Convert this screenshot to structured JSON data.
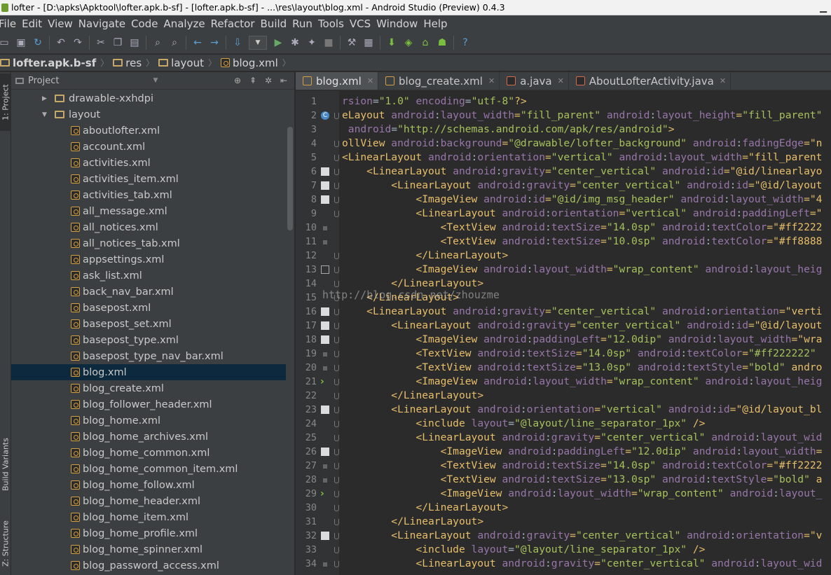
{
  "window": {
    "title": "lofter - [D:\\apks\\Apktool\\lofter.apk.b-sf] - [lofter.apk.b-sf] - ...\\res\\layout\\blog.xml - Android Studio (Preview) 0.4.3"
  },
  "menu": [
    "File",
    "Edit",
    "View",
    "Navigate",
    "Code",
    "Analyze",
    "Refactor",
    "Build",
    "Run",
    "Tools",
    "VCS",
    "Window",
    "Help"
  ],
  "breadcrumb": [
    "lofter.apk.b-sf",
    "res",
    "layout",
    "blog.xml"
  ],
  "left_stripe": {
    "project_tab": "1: Project",
    "build_variants_tab": "Build Variants",
    "structure_tab": "Z: Structure"
  },
  "project_panel": {
    "header": "Project",
    "tree": [
      {
        "label": "drawable-xxhdpi",
        "kind": "folder",
        "expanded": false
      },
      {
        "label": "layout",
        "kind": "folder",
        "expanded": true
      },
      {
        "label": "aboutlofter.xml",
        "kind": "file"
      },
      {
        "label": "account.xml",
        "kind": "file"
      },
      {
        "label": "activities.xml",
        "kind": "file"
      },
      {
        "label": "activities_item.xml",
        "kind": "file"
      },
      {
        "label": "activities_tab.xml",
        "kind": "file"
      },
      {
        "label": "all_message.xml",
        "kind": "file"
      },
      {
        "label": "all_notices.xml",
        "kind": "file"
      },
      {
        "label": "all_notices_tab.xml",
        "kind": "file"
      },
      {
        "label": "appsettings.xml",
        "kind": "file"
      },
      {
        "label": "ask_list.xml",
        "kind": "file"
      },
      {
        "label": "back_nav_bar.xml",
        "kind": "file"
      },
      {
        "label": "basepost.xml",
        "kind": "file"
      },
      {
        "label": "basepost_set.xml",
        "kind": "file"
      },
      {
        "label": "basepost_type.xml",
        "kind": "file"
      },
      {
        "label": "basepost_type_nav_bar.xml",
        "kind": "file"
      },
      {
        "label": "blog.xml",
        "kind": "file",
        "selected": true
      },
      {
        "label": "blog_create.xml",
        "kind": "file"
      },
      {
        "label": "blog_follower_header.xml",
        "kind": "file"
      },
      {
        "label": "blog_home.xml",
        "kind": "file"
      },
      {
        "label": "blog_home_archives.xml",
        "kind": "file"
      },
      {
        "label": "blog_home_common.xml",
        "kind": "file"
      },
      {
        "label": "blog_home_common_item.xml",
        "kind": "file"
      },
      {
        "label": "blog_home_follow.xml",
        "kind": "file"
      },
      {
        "label": "blog_home_header.xml",
        "kind": "file"
      },
      {
        "label": "blog_home_item.xml",
        "kind": "file"
      },
      {
        "label": "blog_home_profile.xml",
        "kind": "file"
      },
      {
        "label": "blog_home_spinner.xml",
        "kind": "file"
      },
      {
        "label": "blog_password_access.xml",
        "kind": "file"
      }
    ]
  },
  "editor_tabs": [
    {
      "label": "blog.xml",
      "active": true,
      "type": "xml"
    },
    {
      "label": "blog_create.xml",
      "active": false,
      "type": "xml"
    },
    {
      "label": "a.java",
      "active": false,
      "type": "java"
    },
    {
      "label": "AboutLofterActivity.java",
      "active": false,
      "type": "java"
    }
  ],
  "watermark": "http://blog.csdn.net/zhouzme",
  "code_lines": [
    "rsion=\"1.0\" encoding=\"utf-8\"?>",
    "eLayout android:layout_width=\"fill_parent\" android:layout_height=\"fill_parent\"",
    " android=\"http://schemas.android.com/apk/res/android\">",
    "ollView android:background=\"@drawable/lofter_background\" android:fadingEdge=\"n",
    "<LinearLayout android:orientation=\"vertical\" android:layout_width=\"fill_parent",
    "    <LinearLayout android:gravity=\"center_vertical\" android:id=\"@id/linearlayo",
    "        <LinearLayout android:gravity=\"center_vertical\" android:id=\"@id/layout",
    "            <ImageView android:id=\"@id/img_msg_header\" android:layout_width=\"4",
    "            <LinearLayout android:orientation=\"vertical\" android:paddingLeft=\"",
    "                <TextView android:textSize=\"14.0sp\" android:textColor=\"#ff2222",
    "                <TextView android:textSize=\"10.0sp\" android:textColor=\"#ff8888",
    "            </LinearLayout>",
    "            <ImageView android:layout_width=\"wrap_content\" android:layout_heig",
    "        </LinearLayout>",
    "    </LinearLayout>",
    "    <LinearLayout android:gravity=\"center_vertical\" android:orientation=\"verti",
    "        <LinearLayout android:gravity=\"center_vertical\" android:id=\"@id/layout",
    "            <ImageView android:paddingLeft=\"12.0dip\" android:layout_width=\"wra",
    "            <TextView android:textSize=\"14.0sp\" android:textColor=\"#ff222222\" ",
    "            <TextView android:textSize=\"13.0sp\" android:textStyle=\"bold\" andro",
    "            <ImageView android:layout_width=\"wrap_content\" android:layout_heig",
    "        </LinearLayout>",
    "        <LinearLayout android:orientation=\"vertical\" android:id=\"@id/layout_bl",
    "            <include layout=\"@layout/line_separator_1px\" />",
    "            <LinearLayout android:gravity=\"center_vertical\" android:layout_wid",
    "                <ImageView android:paddingLeft=\"12.0dip\" android:layout_width=",
    "                <TextView android:textSize=\"14.0sp\" android:textColor=\"#ff2222",
    "                <TextView android:textSize=\"13.0sp\" android:textStyle=\"bold\" a",
    "                <ImageView android:layout_width=\"wrap_content\" android:layout_",
    "            </LinearLayout>",
    "        </LinearLayout>",
    "        <LinearLayout android:gravity=\"center_vertical\" android:orientation=\"v",
    "            <include layout=\"@layout/line_separator_1px\" />",
    "            <LinearLayout android:gravity=\"center_vertical\" android:layout_wid"
  ]
}
